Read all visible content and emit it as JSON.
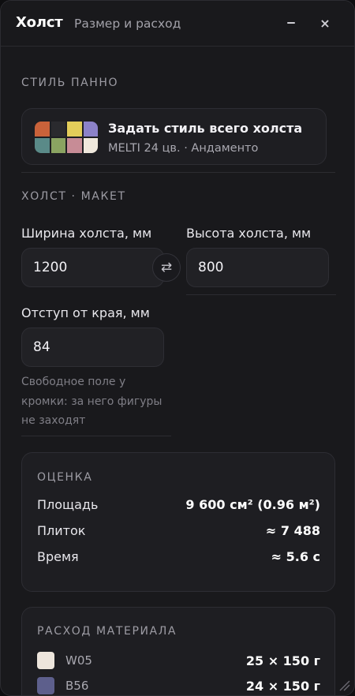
{
  "window": {
    "title": "Холст",
    "subtitle": "Размер и расход",
    "minimize_icon": "minimize-icon",
    "close_label": "×"
  },
  "style_section": {
    "label": "СТИЛЬ ПАННО",
    "card_title": "Задать стиль всего холста",
    "card_subtitle": "MELTI 24 цв. · Андаменто",
    "palette_colors": [
      "#c9623a",
      "#2a2a2e",
      "#e3cd5a",
      "#8c82c8",
      "#5a8a88",
      "#8aa361",
      "#c78c96",
      "#efe8dc"
    ]
  },
  "canvas_section": {
    "label": "ХОЛСТ · МАКЕТ",
    "width_label": "Ширина холста, мм",
    "width_value": "1200",
    "height_label": "Высота холста, мм",
    "height_value": "800",
    "swap_icon": "swap-arrows-icon",
    "swap_glyph": "⇄",
    "margin_label": "Отступ от края, мм",
    "margin_value": "84",
    "margin_hint": "Свободное поле у кромки: за него фигуры не заходят"
  },
  "estimate": {
    "label": "ОЦЕНКА",
    "rows": [
      {
        "label": "Площадь",
        "value": "9 600 см² (0.96 м²)"
      },
      {
        "label": "Плиток",
        "value": "≈ 7 488"
      },
      {
        "label": "Время",
        "value": "≈ 5.6 с"
      }
    ]
  },
  "materials": {
    "label": "РАСХОД МАТЕРИАЛА",
    "items": [
      {
        "name": "W05",
        "amount": "25 × 150 г",
        "color": "#ede5dc"
      },
      {
        "name": "B56",
        "amount": "24 × 150 г",
        "color": "#5d5f8c"
      }
    ]
  },
  "colors": {
    "panel_bg": "#19191c",
    "card_bg": "#1e1e22",
    "input_bg": "#212125",
    "text_primary": "#ecebef",
    "text_muted": "#9d9ca4"
  }
}
